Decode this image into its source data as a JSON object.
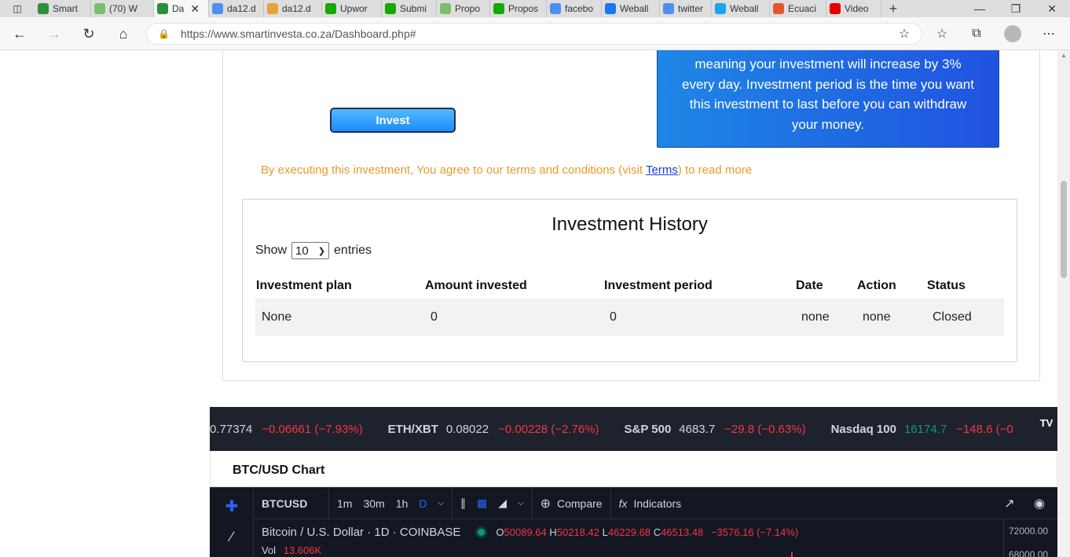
{
  "browser": {
    "tabs": [
      {
        "label": "Smart",
        "color": "#2c8f3c",
        "active": false
      },
      {
        "label": "(70) W",
        "color": "#7bbf6a",
        "active": false
      },
      {
        "label": "Da",
        "color": "#2c8f3c",
        "active": true
      },
      {
        "label": "da12.d",
        "color": "#4e8ff0",
        "active": false
      },
      {
        "label": "da12.d",
        "color": "#e9a23b",
        "active": false
      },
      {
        "label": "Upwor",
        "color": "#14a800",
        "active": false
      },
      {
        "label": "Submi",
        "color": "#14a800",
        "active": false
      },
      {
        "label": "Propo",
        "color": "#7bbf6a",
        "active": false
      },
      {
        "label": "Propos",
        "color": "#14a800",
        "active": false
      },
      {
        "label": "facebo",
        "color": "#4e8ff0",
        "active": false
      },
      {
        "label": "Weball",
        "color": "#1877f2",
        "active": false
      },
      {
        "label": "twitter",
        "color": "#4e8ff0",
        "active": false
      },
      {
        "label": "Weball",
        "color": "#1da1f2",
        "active": false
      },
      {
        "label": "Ecuaci",
        "color": "#e2572b",
        "active": false
      },
      {
        "label": "Video",
        "color": "#e00000",
        "active": false
      }
    ],
    "url": "https://www.smartinvesta.co.za/Dashboard.php#"
  },
  "info_box": {
    "text": "meaning your investment will increase by 3% every day. Investment period is the time you want this investment to last before you can withdraw your money."
  },
  "invest_button": "Invest",
  "terms": {
    "before": "By executing this investment, You agree to our terms and conditions (visit ",
    "link": "Terms",
    "after": ") to read more"
  },
  "history": {
    "title": "Investment History",
    "show_label": "Show",
    "entries_value": "10",
    "entries_label": "entries",
    "columns": [
      "Investment plan",
      "Amount invested",
      "Investment period",
      "Date",
      "Action",
      "Status"
    ],
    "rows": [
      [
        "None",
        "0",
        "0",
        "none",
        "none",
        "Closed"
      ]
    ]
  },
  "ticker": [
    {
      "symbol": "",
      "value": "0.77374",
      "change": "−0.06661 (−7.93%)",
      "trend": "neg"
    },
    {
      "symbol": "ETH/XBT",
      "value": "0.08022",
      "change": "−0.00228 (−2.76%)",
      "trend": "neg"
    },
    {
      "symbol": "S&P 500",
      "value": "4683.7",
      "change": "−29.8 (−0.63%)",
      "trend": "neg"
    },
    {
      "symbol": "Nasdaq 100",
      "value": "16174.7",
      "change": "−148.6 (−0",
      "trend": "pos"
    }
  ],
  "chart": {
    "section_title": "BTC/USD Chart",
    "symbol": "BTCUSD",
    "intervals": [
      "1m",
      "30m",
      "1h",
      "D"
    ],
    "active_interval": "D",
    "compare_label": "Compare",
    "indicators_label": "Indicators",
    "legend_name": "Bitcoin / U.S. Dollar · 1D · COINBASE",
    "ohlc": {
      "O": "50089.64",
      "H": "50218.42",
      "L": "46229.68",
      "C": "46513.48",
      "change": "−3576.16 (−7.14%)"
    },
    "vol_label": "Vol",
    "vol_value": "13.606K",
    "price_axis": [
      "72000.00",
      "68000.00"
    ]
  }
}
